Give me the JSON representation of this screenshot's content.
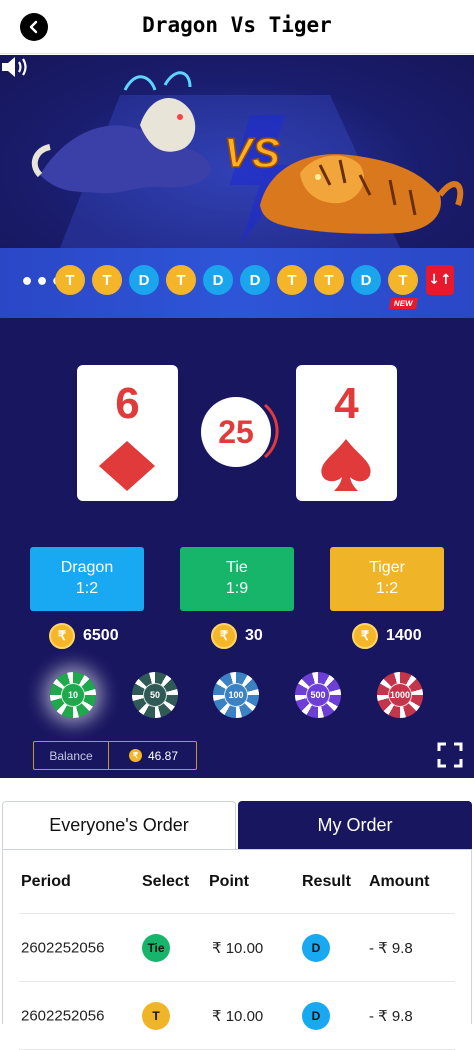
{
  "header": {
    "title": "Dragon Vs Tiger"
  },
  "banner": {
    "vs_text": "VS"
  },
  "history": {
    "more": "•••",
    "results": [
      "T",
      "T",
      "D",
      "T",
      "D",
      "D",
      "T",
      "T",
      "D",
      "T"
    ],
    "new_badge": "NEW",
    "sort_label": "↓↑"
  },
  "round": {
    "dragon_card": {
      "value": "6",
      "suit": "diamond"
    },
    "tiger_card": {
      "value": "4",
      "suit": "spade"
    },
    "countdown": "25"
  },
  "bets": {
    "dragon": {
      "label": "Dragon",
      "odds": "1:2",
      "pool": "6500"
    },
    "tie": {
      "label": "Tie",
      "odds": "1:9",
      "pool": "30"
    },
    "tiger": {
      "label": "Tiger",
      "odds": "1:2",
      "pool": "1400"
    },
    "coin_symbol": "₹"
  },
  "chips": [
    {
      "value": "10",
      "color": "#1fa94c",
      "selected": true
    },
    {
      "value": "50",
      "color": "#2f5a55",
      "selected": false
    },
    {
      "value": "100",
      "color": "#3b82c4",
      "selected": false
    },
    {
      "value": "500",
      "color": "#6d3fd6",
      "selected": false
    },
    {
      "value": "1000",
      "color": "#c5344a",
      "selected": false
    }
  ],
  "balance": {
    "label": "Balance",
    "amount": "46.87"
  },
  "tabs": {
    "everyone": "Everyone's Order",
    "mine": "My Order"
  },
  "orders": {
    "columns": [
      "Period",
      "Select",
      "Point",
      "Result",
      "Amount"
    ],
    "rows": [
      {
        "period": "2602252056",
        "select": "Tie",
        "point": "₹ 10.00",
        "result": "D",
        "amount": "- ₹ 9.8"
      },
      {
        "period": "2602252056",
        "select": "T",
        "point": "₹ 10.00",
        "result": "D",
        "amount": "- ₹ 9.8"
      }
    ]
  },
  "colors": {
    "accent": "#191660",
    "dragon": "#18a9f2",
    "tie": "#17b56a",
    "tiger": "#f0b429",
    "card_red": "#e03a3a"
  }
}
